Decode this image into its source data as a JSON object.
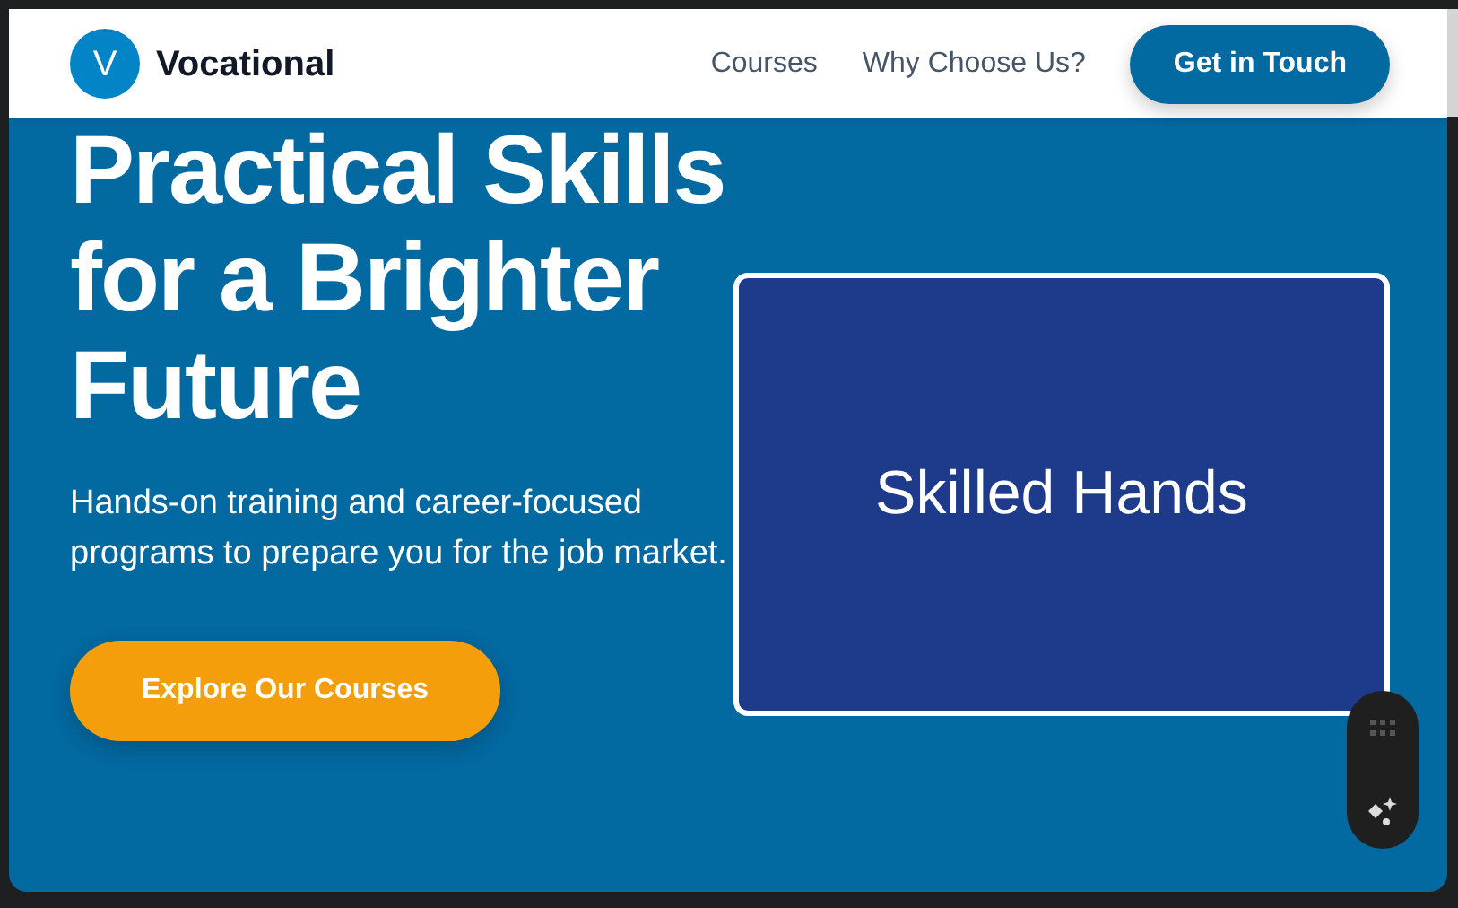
{
  "brand": {
    "logo_letter": "V",
    "name": "Vocational"
  },
  "nav": [
    {
      "label": "Courses"
    },
    {
      "label": "Why Choose Us?"
    }
  ],
  "cta": {
    "label": "Get in Touch"
  },
  "hero": {
    "title": "Practical Skills for a Brighter Future",
    "text": "Hands-on training and career-focused programs to prepare you for the job market.",
    "button": "Explore Our Courses",
    "image_label": "Skilled Hands"
  }
}
